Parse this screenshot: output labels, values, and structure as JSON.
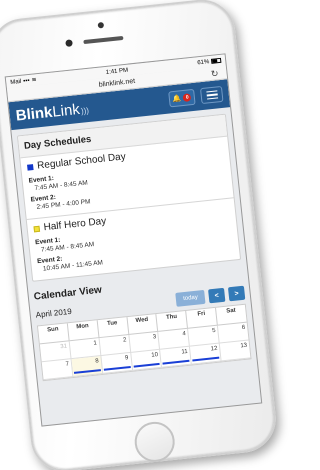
{
  "status": {
    "carrier": "Mail",
    "time": "1:41 PM",
    "battery": "61%"
  },
  "browser": {
    "url": "blinklink.net"
  },
  "navbar": {
    "brand_bold": "Blink",
    "brand_light": "Link",
    "notification_count": "0"
  },
  "day_schedules": {
    "heading": "Day Schedules",
    "items": [
      {
        "name": "Regular School Day",
        "color": "#1237c9",
        "events": [
          {
            "label": "Event 1:",
            "time": "7:45 AM - 8:45 AM"
          },
          {
            "label": "Event 2:",
            "time": "2:45 PM - 4:00 PM"
          }
        ]
      },
      {
        "name": "Half Hero Day",
        "color": "#f3e23a",
        "events": [
          {
            "label": "Event 1:",
            "time": "7:45 AM - 8:45 AM"
          },
          {
            "label": "Event 2:",
            "time": "10:45 AM - 11:45 AM"
          }
        ]
      }
    ]
  },
  "calendar": {
    "heading": "Calendar View",
    "month": "April 2019",
    "today_label": "today",
    "prev_label": "<",
    "next_label": ">",
    "weekdays": [
      "Sun",
      "Mon",
      "Tue",
      "Wed",
      "Thu",
      "Fri",
      "Sat"
    ],
    "weeks": [
      [
        "31",
        "1",
        "2",
        "3",
        "4",
        "5",
        "6"
      ],
      [
        "7",
        "8",
        "9",
        "10",
        "11",
        "12",
        "13"
      ]
    ]
  },
  "colors": {
    "navbar": "#24588f",
    "accent": "#337ab7"
  }
}
